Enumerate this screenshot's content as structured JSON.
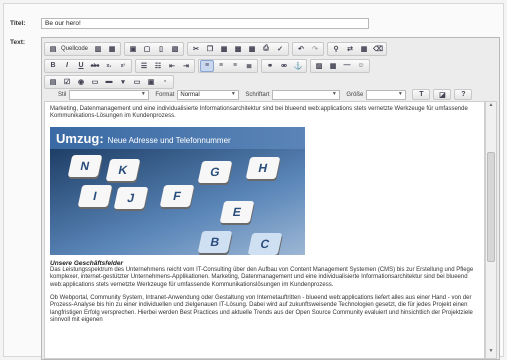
{
  "form": {
    "title_label": "Titel:",
    "title_value": "Be our hero!",
    "text_label": "Text:"
  },
  "toolbar": {
    "source_label": "Quellcode",
    "style_label": "Stil",
    "format_label": "Format",
    "format_value": "Normal",
    "font_label": "Schriftart",
    "size_label": "Größe"
  },
  "content": {
    "intro": "Marketing, Datenmanagement und eine individualisierte Informationsarchitektur sind bei blueend web:applications stets vernetzte Werkzeuge für umfassende Kommunikations-Lösungen im Kundenprozess.",
    "banner_title": "Umzug:",
    "banner_subtitle": "Neue Adresse und Telefonnummer",
    "keys": [
      "N",
      "K",
      "I",
      "J",
      "G",
      "F",
      "H",
      "E",
      "B",
      "C"
    ],
    "section_heading": "Unsere Geschäftsfelder",
    "para1": "Das Leistungsspektrum des Unternehmens reicht vom IT-Consulting über den Aufbau von Content Management Systemen (CMS) bis zur Erstellung und Pflege komplexer, internet-gestützter Unternehmens-Applikationen. Marketing, Datenmanagement und eine individualisierte Informationsarchitektur sind bei blueend web:applications stets vernetzte Werkzeuge für umfassende Kommunikationslösungen im Kundenprozess.",
    "para2": "Ob Webportal, Community System, Intranet-Anwendung oder Gestaltung von Internetauftritten - blueend web:applications liefert alles aus einer Hand - von der Prozess-Analyse bis hin zu einer individuellen und zielgenauen IT-Lösung. Dabei wird auf zukunftsweisende Technologien gesetzt, die für jedes Projekt einen langfristigen Erfolg versprechen. Hierbei werden Best Practices und aktuelle Trends aus der Open Source Community evaluiert und hinsichtlich der Projektziele sinnvoll mit eigenen"
  }
}
